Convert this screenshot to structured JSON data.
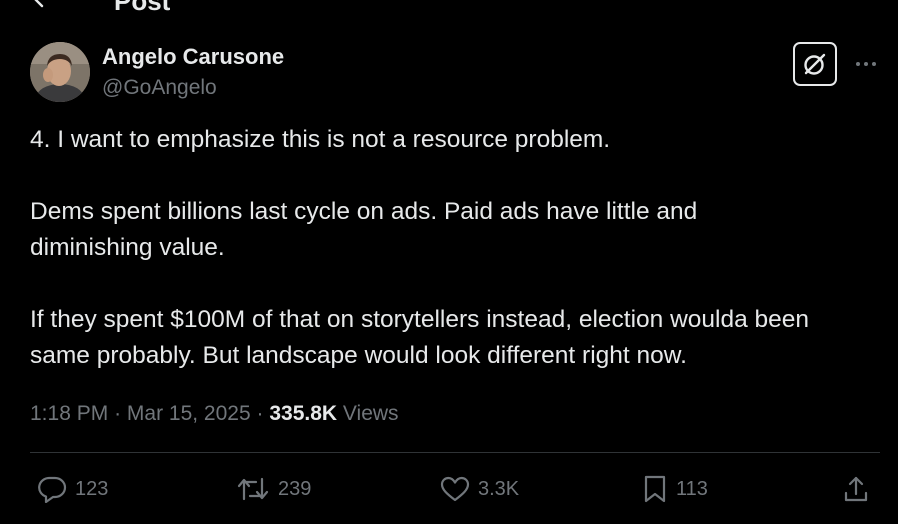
{
  "header": {
    "title": "Post"
  },
  "author": {
    "display_name": "Angelo Carusone",
    "handle": "@GoAngelo"
  },
  "post": {
    "paragraphs": [
      "4. I want to emphasize this is not a resource problem.",
      "Dems spent billions last cycle on ads. Paid ads have little and\ndiminishing value.",
      "If they spent $100M of that on storytellers instead, election woulda been\nsame probably. But landscape would look different right now."
    ],
    "time": "1:18 PM",
    "separator": "·",
    "date": "Mar 15, 2025",
    "views_count": "335.8K",
    "views_label": "Views"
  },
  "actions": {
    "replies": "123",
    "reposts": "239",
    "likes": "3.3K",
    "bookmarks": "113"
  },
  "icons": {
    "back": "arrow-left-icon",
    "grok": "grok-icon",
    "more": "more-horizontal-icon",
    "reply": "speech-bubble-icon",
    "repost": "repost-arrows-icon",
    "like": "heart-icon",
    "bookmark": "bookmark-icon",
    "share": "share-upload-icon"
  },
  "colors": {
    "background": "#000000",
    "primary_text": "#e7e9ea",
    "secondary_text": "#71767b",
    "divider": "#2f3336"
  }
}
